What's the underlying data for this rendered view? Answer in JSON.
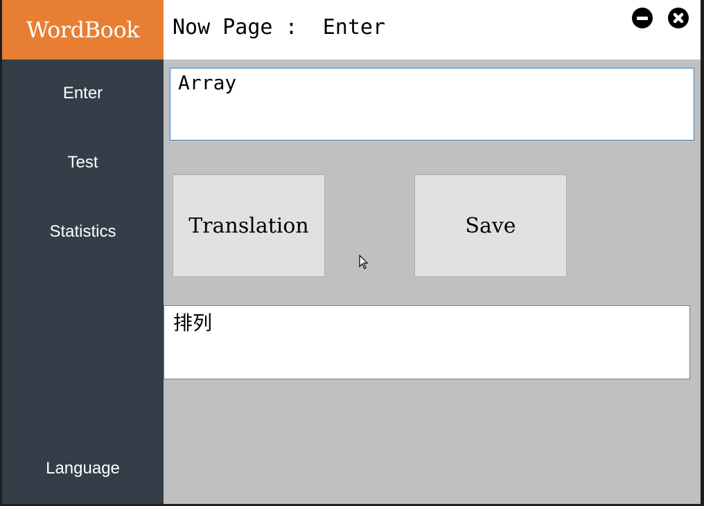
{
  "app": {
    "title": "WordBook"
  },
  "sidebar": {
    "items": [
      {
        "label": "Enter"
      },
      {
        "label": "Test"
      },
      {
        "label": "Statistics"
      }
    ],
    "language_label": "Language"
  },
  "header": {
    "now_page_label": "Now Page :",
    "current_page": "Enter",
    "minimize_icon": "minus-circle-icon",
    "close_icon": "x-circle-icon"
  },
  "main": {
    "word_input_value": "Array",
    "translation_button": "Translation",
    "save_button": "Save",
    "result_value": "排列"
  },
  "colors": {
    "brand": "#e87e32",
    "sidebar": "#333e49",
    "content_bg": "#c0c0c0"
  }
}
